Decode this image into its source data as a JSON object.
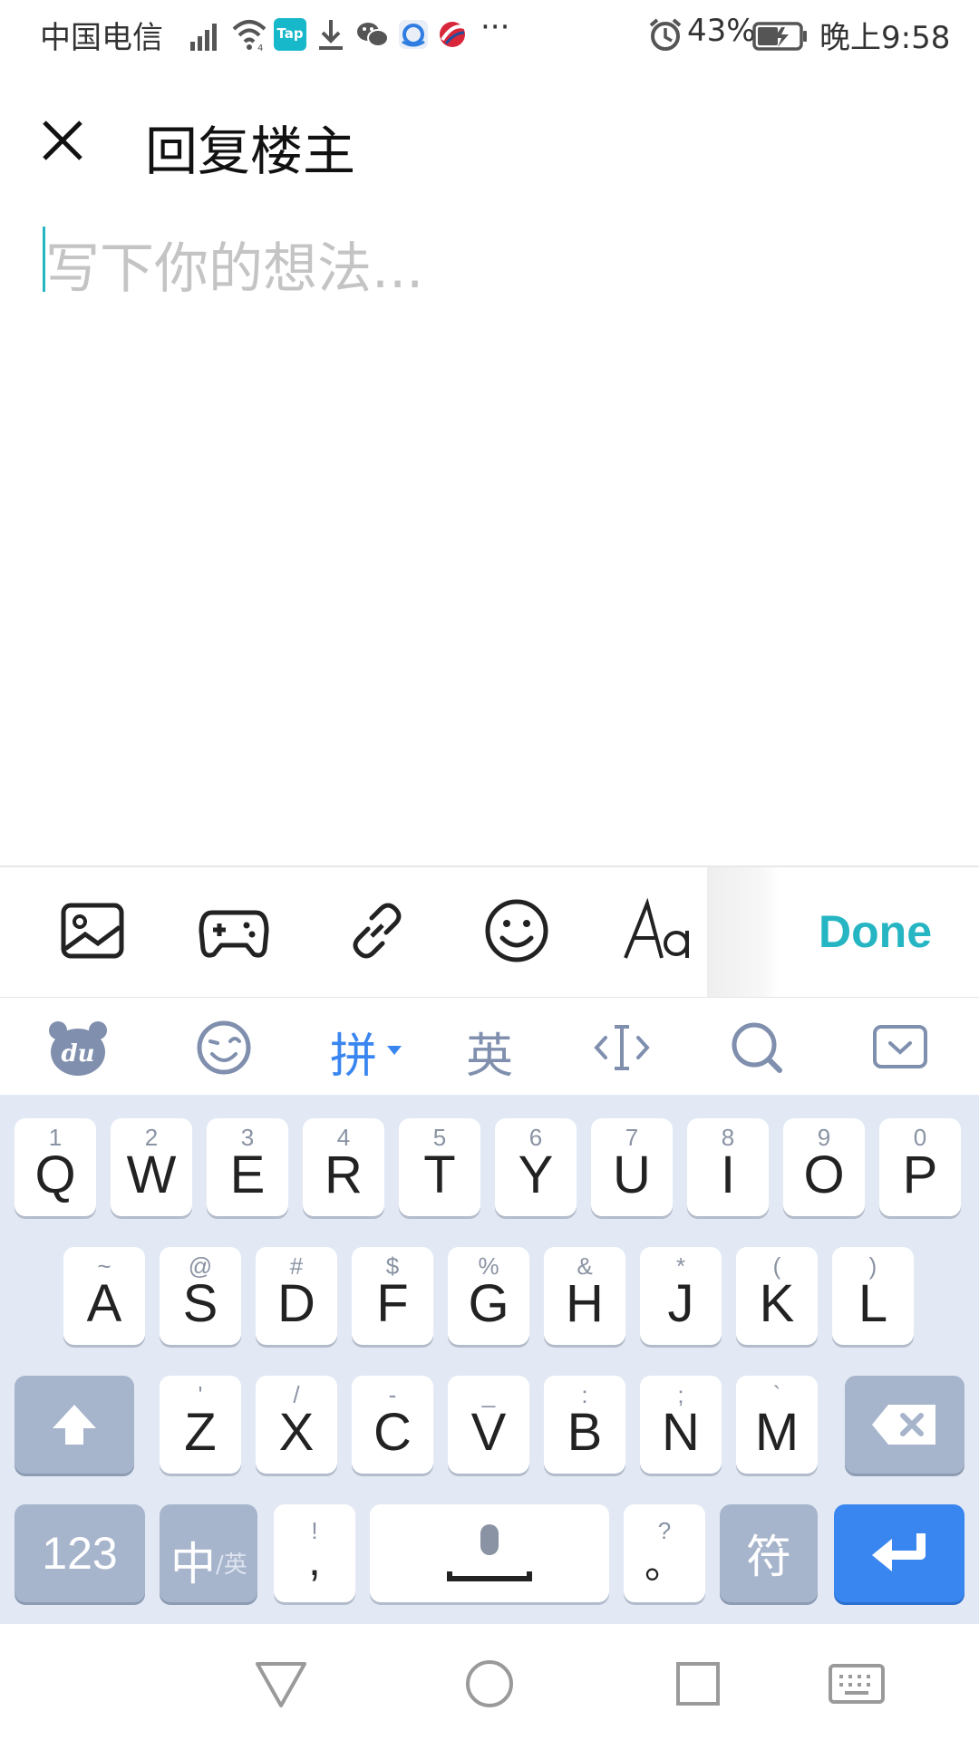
{
  "status_bar": {
    "carrier": "中国电信",
    "tap_badge": "Tap",
    "more": "···",
    "battery": "43%",
    "time": "晚上9:58"
  },
  "header": {
    "title": "回复楼主"
  },
  "editor": {
    "placeholder": "写下你的想法..."
  },
  "toolbar": {
    "done_label": "Done",
    "accent_color": "#26b6c3"
  },
  "ime_bar": {
    "logo_text": "du",
    "pinyin_label": "拼",
    "english_label": "英"
  },
  "keyboard": {
    "row1": [
      {
        "main": "Q",
        "sub": "1"
      },
      {
        "main": "W",
        "sub": "2"
      },
      {
        "main": "E",
        "sub": "3"
      },
      {
        "main": "R",
        "sub": "4"
      },
      {
        "main": "T",
        "sub": "5"
      },
      {
        "main": "Y",
        "sub": "6"
      },
      {
        "main": "U",
        "sub": "7"
      },
      {
        "main": "I",
        "sub": "8"
      },
      {
        "main": "O",
        "sub": "9"
      },
      {
        "main": "P",
        "sub": "0"
      }
    ],
    "row2": [
      {
        "main": "A",
        "sub": "~"
      },
      {
        "main": "S",
        "sub": "@"
      },
      {
        "main": "D",
        "sub": "#"
      },
      {
        "main": "F",
        "sub": "$"
      },
      {
        "main": "G",
        "sub": "%"
      },
      {
        "main": "H",
        "sub": "&"
      },
      {
        "main": "J",
        "sub": "*"
      },
      {
        "main": "K",
        "sub": "("
      },
      {
        "main": "L",
        "sub": ")"
      }
    ],
    "row3": [
      {
        "main": "Z",
        "sub": "'"
      },
      {
        "main": "X",
        "sub": "/"
      },
      {
        "main": "C",
        "sub": "-"
      },
      {
        "main": "V",
        "sub": "_"
      },
      {
        "main": "B",
        "sub": ":"
      },
      {
        "main": "N",
        "sub": ";"
      },
      {
        "main": "M",
        "sub": "`"
      }
    ],
    "num_label": "123",
    "lang_label": "中",
    "lang_sub_label": "/英",
    "comma_main": ",",
    "comma_sub": "!",
    "period_main": "。",
    "period_sub": "?",
    "symbol_label": "符",
    "enter_color": "#3a86f0"
  }
}
